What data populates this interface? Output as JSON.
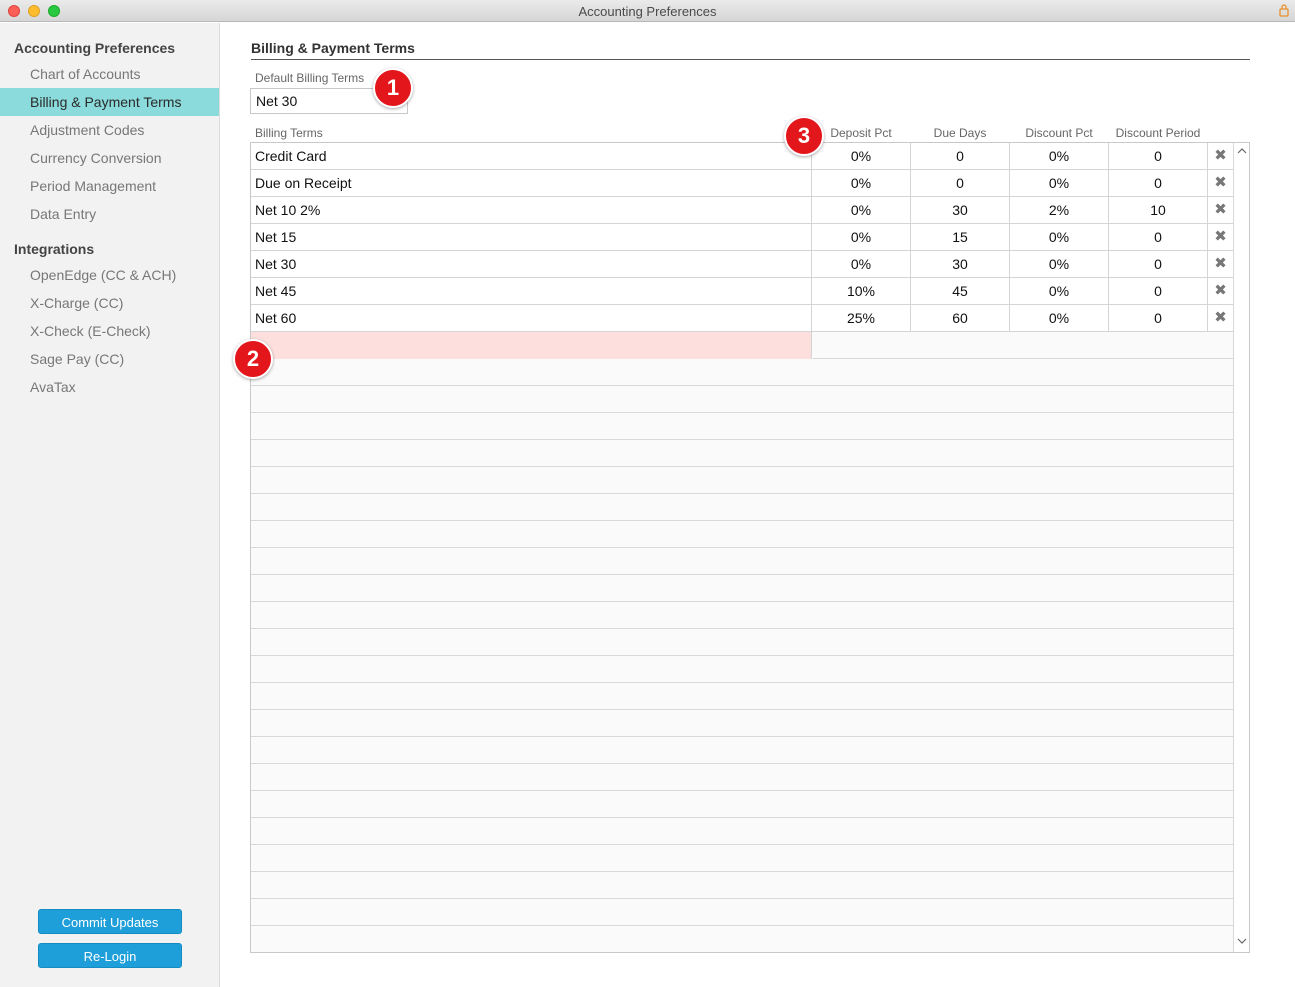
{
  "window": {
    "title": "Accounting Preferences"
  },
  "sidebar": {
    "heading_prefs": "Accounting Preferences",
    "pref_items": [
      {
        "label": "Chart of Accounts"
      },
      {
        "label": "Billing & Payment Terms",
        "active": true
      },
      {
        "label": "Adjustment Codes"
      },
      {
        "label": "Currency Conversion"
      },
      {
        "label": "Period Management"
      },
      {
        "label": "Data Entry"
      }
    ],
    "heading_integrations": "Integrations",
    "integration_items": [
      {
        "label": "OpenEdge (CC & ACH)"
      },
      {
        "label": "X-Charge (CC)"
      },
      {
        "label": "X-Check (E-Check)"
      },
      {
        "label": "Sage Pay (CC)"
      },
      {
        "label": "AvaTax"
      }
    ],
    "commit_button": "Commit Updates",
    "relogin_button": "Re-Login"
  },
  "main": {
    "section_title": "Billing & Payment Terms",
    "default_terms_label": "Default Billing Terms",
    "default_terms_value": "Net 30",
    "table": {
      "headers": [
        "Billing Terms",
        "Deposit Pct",
        "Due Days",
        "Discount Pct",
        "Discount Period"
      ],
      "rows": [
        {
          "name": "Credit Card",
          "deposit": "0%",
          "due": "0",
          "discount": "0%",
          "period": "0"
        },
        {
          "name": "Due on Receipt",
          "deposit": "0%",
          "due": "0",
          "discount": "0%",
          "period": "0"
        },
        {
          "name": "Net 10 2%",
          "deposit": "0%",
          "due": "30",
          "discount": "2%",
          "period": "10"
        },
        {
          "name": "Net 15",
          "deposit": "0%",
          "due": "15",
          "discount": "0%",
          "period": "0"
        },
        {
          "name": "Net 30",
          "deposit": "0%",
          "due": "30",
          "discount": "0%",
          "period": "0"
        },
        {
          "name": "Net 45",
          "deposit": "10%",
          "due": "45",
          "discount": "0%",
          "period": "0"
        },
        {
          "name": "Net 60",
          "deposit": "25%",
          "due": "60",
          "discount": "0%",
          "period": "0"
        }
      ],
      "delete_glyph": "✖"
    }
  },
  "annotations": [
    "1",
    "2",
    "3"
  ],
  "colors": {
    "active_item": "#8bdbdc",
    "button": "#1e9fda",
    "new_row": "#fde0de",
    "badge": "#e3161c"
  },
  "icons": {
    "titlebar_right": "lock-icon",
    "scroll_up": "chevron-up-icon",
    "scroll_down": "chevron-down-icon"
  }
}
